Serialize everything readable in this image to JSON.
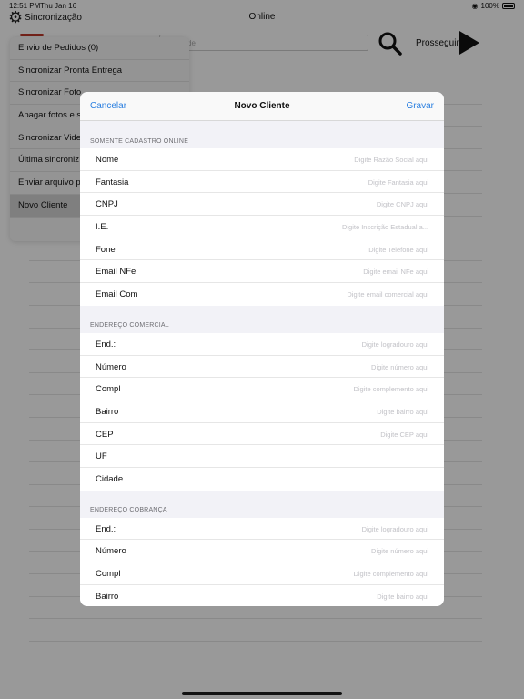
{
  "status_bar": {
    "time": "12:51 PM",
    "date": "Thu Jan 16",
    "battery": "100%"
  },
  "background": {
    "title": "Online",
    "sync_label": "Sincronização",
    "search_placeholder": "de",
    "proceed_label": "Prosseguir"
  },
  "menu": {
    "items": [
      "Envio de Pedidos  (0)",
      "Sincronizar Pronta Entrega",
      "Sincronizar Foto",
      "Apagar fotos e s",
      "Sincronizar Vide",
      "Última sincroniz",
      "Enviar arquivo p",
      "Novo Cliente"
    ],
    "selected_index": 7
  },
  "modal": {
    "cancel_label": "Cancelar",
    "title": "Novo Cliente",
    "save_label": "Gravar",
    "sections": [
      {
        "header": "SOMENTE CADASTRO ONLINE",
        "rows": [
          {
            "label": "Nome",
            "placeholder": "Digite Razão Social aqui"
          },
          {
            "label": "Fantasia",
            "placeholder": "Digite Fantasia aqui"
          },
          {
            "label": "CNPJ",
            "placeholder": "Digite CNPJ aqui"
          },
          {
            "label": "I.E.",
            "placeholder": "Digite Inscrição Estadual a..."
          },
          {
            "label": "Fone",
            "placeholder": "Digite Telefone aqui"
          },
          {
            "label": "Email NFe",
            "placeholder": "Digite email NFe aqui"
          },
          {
            "label": "Email Com",
            "placeholder": "Digite email comercial aqui"
          }
        ]
      },
      {
        "header": "ENDEREÇO COMERCIAL",
        "rows": [
          {
            "label": "End.:",
            "placeholder": "Digite logradouro aqui"
          },
          {
            "label": "Número",
            "placeholder": "Digite número aqui"
          },
          {
            "label": "Compl",
            "placeholder": "Digite complemento aqui"
          },
          {
            "label": "Bairro",
            "placeholder": "Digite bairro aqui"
          },
          {
            "label": "CEP",
            "placeholder": "Digite CEP aqui"
          },
          {
            "label": "UF",
            "placeholder": ""
          },
          {
            "label": "Cidade",
            "placeholder": ""
          }
        ]
      },
      {
        "header": "ENDEREÇO COBRANÇA",
        "rows": [
          {
            "label": "End.:",
            "placeholder": "Digite logradouro aqui"
          },
          {
            "label": "Número",
            "placeholder": "Digite número aqui"
          },
          {
            "label": "Compl",
            "placeholder": "Digite complemento aqui"
          },
          {
            "label": "Bairro",
            "placeholder": "Digite bairro aqui"
          }
        ]
      }
    ]
  },
  "colors": {
    "accent": "#2a7fe0",
    "brand_red": "#c0392b",
    "dim_overlay": "rgba(0,0,0,0.4)"
  }
}
